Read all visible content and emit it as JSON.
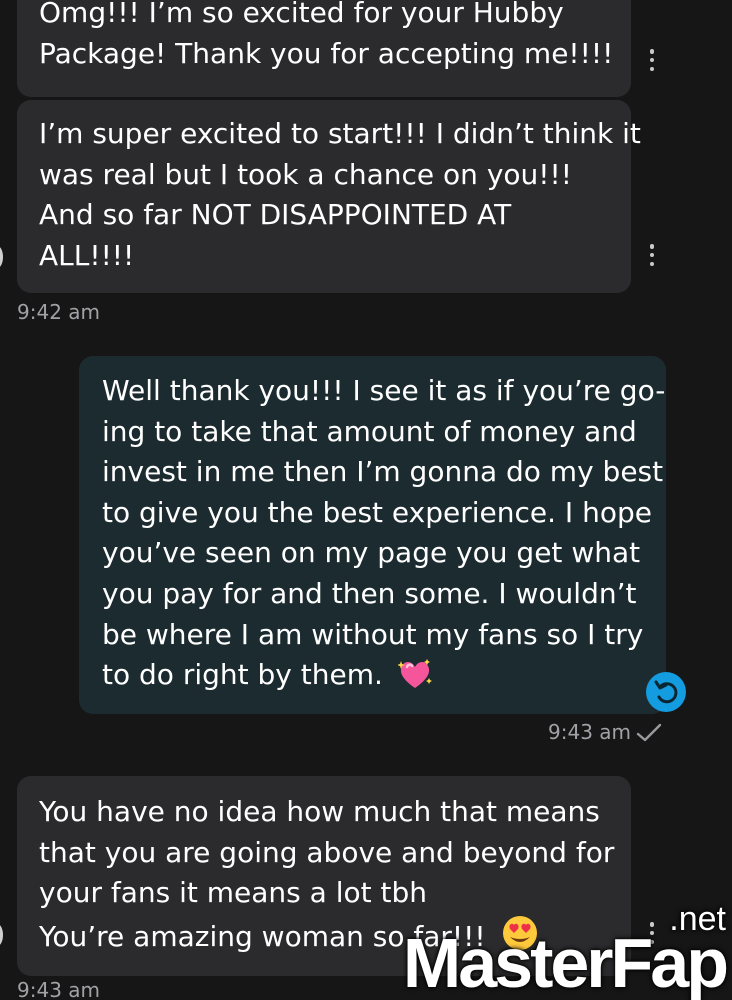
{
  "messages": [
    {
      "side": "incoming",
      "lines": [
        "Omg!!! I’m so excited for your Hubby",
        "Package! Thank you for accepting me!!!!"
      ]
    },
    {
      "side": "incoming",
      "lines": [
        "I’m super excited to start!!! I didn’t think it",
        "was real but I took a chance on you!!!",
        "And so far NOT DISAPPOINTED AT",
        "ALL!!!!"
      ],
      "time": "9:42 am"
    },
    {
      "side": "outgoing",
      "lines": [
        "Well thank you!!! I see it as if you’re go-",
        "ing to take that amount of money and",
        "invest in me then I’m gonna do my best",
        "to give you the best experience. I hope",
        "you’ve seen on my page you get what",
        "you pay for and then some. I wouldn’t",
        "be where I am without my fans so I try",
        "to do right by them."
      ],
      "emoji": "sparkling-heart-emoji",
      "time": "9:43 am",
      "status_icon": "check-icon"
    },
    {
      "side": "incoming",
      "lines": [
        "You have no idea how much that means",
        "that you are going above and beyond for",
        "your fans it means a lot tbh",
        "You’re amazing woman so far!!!"
      ],
      "emoji": "heart-eyes-emoji",
      "time": "9:43 am"
    }
  ],
  "watermark": {
    "brand": "MasterFap",
    "tld": ".net"
  },
  "colors": {
    "background": "#161617",
    "incoming_bubble": "#2b2b2d",
    "outgoing_bubble": "#1c2b30",
    "reply_button": "#139ce0",
    "timestamp": "#a2a2a6"
  }
}
